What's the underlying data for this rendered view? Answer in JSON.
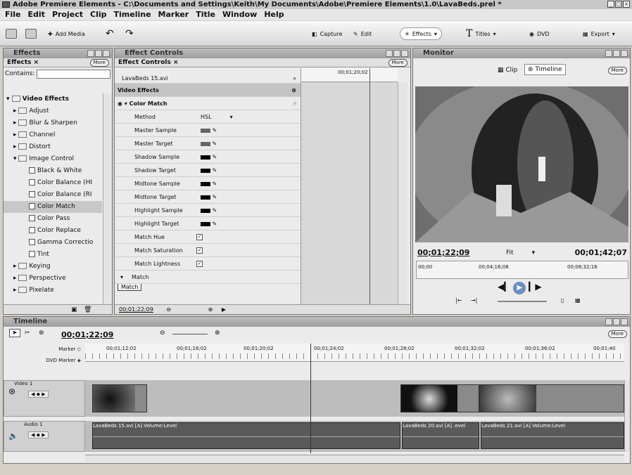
{
  "title": "Adobe Premiere Elements - C:\\Documents and Settings\\Keith\\My Documents\\Adobe\\Premiere Elements\\1.0\\LavaBeds.prel *",
  "menu": [
    "File",
    "Edit",
    "Project",
    "Clip",
    "Timeline",
    "Marker",
    "Title",
    "Window",
    "Help"
  ],
  "toolbar": {
    "add_media": "Add Media",
    "capture": "Capture",
    "edit": "Edit",
    "effects": "Effects",
    "titles": "Titles",
    "dvd": "DVD",
    "export": "Export"
  },
  "effects_panel": {
    "title": "Effects",
    "tab": "Effects",
    "more": "More",
    "contains_label": "Contains:",
    "contains_value": "",
    "items": [
      "Video Effects",
      "Adjust",
      "Blur & Sharpen",
      "Channel",
      "Distort",
      "Image Control",
      "Black & White",
      "Color Balance (HI",
      "Color Balance (RI",
      "Color Match",
      "Color Pass",
      "Color Replace",
      "Gamma Correctio",
      "Tint",
      "Keying",
      "Perspective",
      "Pixelate"
    ]
  },
  "effect_controls": {
    "title": "Effect Controls",
    "tab": "Effect Controls",
    "more": "More",
    "clip_name": "LavaBeds 15.avi",
    "ruler_time": "00;01;20;02",
    "section": "Video Effects",
    "effect": "Color Match",
    "method_label": "Method",
    "method_value": "HSL",
    "params": [
      "Master Sample",
      "Master Target",
      "Shadow Sample",
      "Shadow Target",
      "Midtone Sample",
      "Midtone Target",
      "Highlight Sample",
      "Highlight Target"
    ],
    "checks": [
      "Match Hue",
      "Match Saturation",
      "Match Lightness"
    ],
    "match_label": "Match",
    "match_button": "Match",
    "timecode": "00;01;22;09"
  },
  "monitor": {
    "title": "Monitor",
    "clip": "Clip",
    "timeline": "Timeline",
    "more": "More",
    "current_time": "00;01;22;09",
    "fit": "Fit",
    "duration": "00;01;42;07",
    "ruler": [
      "00;00",
      "00;04;16;08",
      "00;08;32;16"
    ]
  },
  "timeline": {
    "title": "Timeline",
    "timecode": "00;01;22;09",
    "more": "More",
    "marker": "Marker",
    "dvd_marker": "DVD Marker",
    "video_track": "Video 1",
    "audio_track": "Audio 1",
    "ruler": [
      "00;01;12;02",
      "00;01;16;02",
      "00;01;20;02",
      "00;01;24;02",
      "00;01;28;02",
      "00;01;32;02",
      "00;01;36;02",
      "00;01;40"
    ],
    "audio_clips": [
      "LavaBeds 15.avi [A] Volume:Level",
      "LavaBeds 20.avi [A] .evel",
      "LavaBeds 21.avi [A] Volume:Level"
    ]
  }
}
